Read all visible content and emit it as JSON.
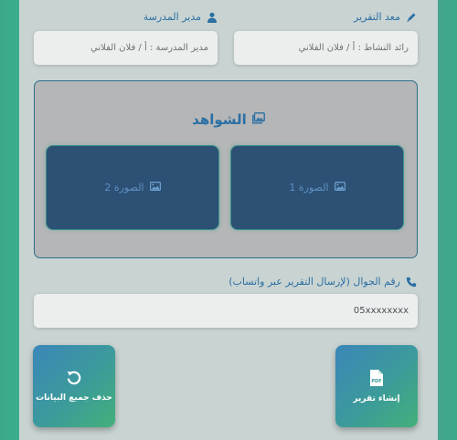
{
  "fields": {
    "preparer": {
      "label": "معد التقرير",
      "placeholder": "رائد النشاط : أ / فلان الفلاني",
      "icon": "pen-icon"
    },
    "principal": {
      "label": "مدير المدرسة",
      "placeholder": "مدير المدرسة : أ / فلان الفلاني",
      "icon": "user-tie-icon"
    },
    "phone": {
      "label": "رقم الجوال (لإرسال التقرير عبر واتساب)",
      "placeholder": "05xxxxxxxx",
      "icon": "phone-icon"
    }
  },
  "evidence": {
    "title": "الشواهد",
    "photos": [
      "الصورة 1",
      "الصورة 2"
    ]
  },
  "buttons": {
    "create_report": "إنشاء تقرير",
    "delete_data": "حذف جميع البيانات"
  },
  "colors": {
    "accent": "#2b6fa3",
    "photo_bg": "#2c5175",
    "button_gradient_start": "#3b86b9",
    "button_gradient_end": "#43b07a"
  }
}
